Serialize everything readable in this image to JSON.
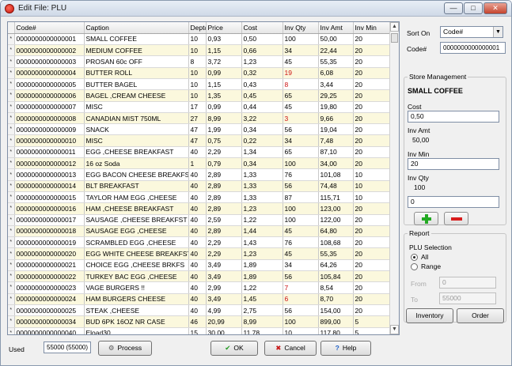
{
  "window": {
    "title": "Edit File: PLU"
  },
  "grid": {
    "columns": [
      "Code#",
      "Caption",
      "Dept#",
      "Price",
      "Cost",
      "Inv Qty",
      "Inv Amt",
      "Inv Min"
    ],
    "rows": [
      [
        "0000000000000001",
        "SMALL COFFEE",
        "10",
        "0,93",
        "0,50",
        "100",
        "50,00",
        "20"
      ],
      [
        "0000000000000002",
        "MEDIUM COFFEE",
        "10",
        "1,15",
        "0,66",
        "34",
        "22,44",
        "20"
      ],
      [
        "0000000000000003",
        "PROSAN 60c OFF",
        "8",
        "3,72",
        "1,23",
        "45",
        "55,35",
        "20"
      ],
      [
        "0000000000000004",
        "BUTTER ROLL",
        "10",
        "0,99",
        "0,32",
        "19",
        "6,08",
        "20"
      ],
      [
        "0000000000000005",
        "BUTTER BAGEL",
        "10",
        "1,15",
        "0,43",
        "8",
        "3,44",
        "20"
      ],
      [
        "0000000000000006",
        "BAGEL ,CREAM CHEESE",
        "10",
        "1,35",
        "0,45",
        "65",
        "29,25",
        "20"
      ],
      [
        "0000000000000007",
        "MISC",
        "17",
        "0,99",
        "0,44",
        "45",
        "19,80",
        "20"
      ],
      [
        "0000000000000008",
        "CANADIAN MIST 750ML",
        "27",
        "8,99",
        "3,22",
        "3",
        "9,66",
        "20"
      ],
      [
        "0000000000000009",
        "SNACK",
        "47",
        "1,99",
        "0,34",
        "56",
        "19,04",
        "20"
      ],
      [
        "0000000000000010",
        "MISC",
        "47",
        "0,75",
        "0,22",
        "34",
        "7,48",
        "20"
      ],
      [
        "0000000000000011",
        "EGG ,CHEESE BREAKFAST",
        "40",
        "2,29",
        "1,34",
        "65",
        "87,10",
        "20"
      ],
      [
        "0000000000000012",
        "16 oz Soda",
        "1",
        "0,79",
        "0,34",
        "100",
        "34,00",
        "20"
      ],
      [
        "0000000000000013",
        "EGG BACON CHEESE BREAKFST",
        "40",
        "2,89",
        "1,33",
        "76",
        "101,08",
        "10"
      ],
      [
        "0000000000000014",
        "BLT BREAKFAST",
        "40",
        "2,89",
        "1,33",
        "56",
        "74,48",
        "10"
      ],
      [
        "0000000000000015",
        "TAYLOR HAM EGG ,CHEESE",
        "40",
        "2,89",
        "1,33",
        "87",
        "115,71",
        "10"
      ],
      [
        "0000000000000016",
        "HAM ,CHEESE BREAKFAST",
        "40",
        "2,89",
        "1,23",
        "100",
        "123,00",
        "20"
      ],
      [
        "0000000000000017",
        "SAUSAGE ,CHEESE BREAKFST",
        "40",
        "2,59",
        "1,22",
        "100",
        "122,00",
        "20"
      ],
      [
        "0000000000000018",
        "SAUSAGE EGG ,CHEESE",
        "40",
        "2,89",
        "1,44",
        "45",
        "64,80",
        "20"
      ],
      [
        "0000000000000019",
        "SCRAMBLED EGG ,CHEESE",
        "40",
        "2,29",
        "1,43",
        "76",
        "108,68",
        "20"
      ],
      [
        "0000000000000020",
        "EGG WHITE CHEESE BREAKFST",
        "40",
        "2,29",
        "1,23",
        "45",
        "55,35",
        "20"
      ],
      [
        "0000000000000021",
        "CHOICE EGG ,CHEESE BRKFS",
        "40",
        "3,49",
        "1,89",
        "34",
        "64,26",
        "20"
      ],
      [
        "0000000000000022",
        "TURKEY BAC EGG ,CHEESE",
        "40",
        "3,49",
        "1,89",
        "56",
        "105,84",
        "20"
      ],
      [
        "0000000000000023",
        "VAGE BURGERS !!",
        "40",
        "2,99",
        "1,22",
        "7",
        "8,54",
        "20"
      ],
      [
        "0000000000000024",
        "HAM BURGERS CHEESE",
        "40",
        "3,49",
        "1,45",
        "6",
        "8,70",
        "20"
      ],
      [
        "0000000000000025",
        "STEAK ,CHEESE",
        "40",
        "4,99",
        "2,75",
        "56",
        "154,00",
        "20"
      ],
      [
        "0000000000000034",
        "BUD 6PK 16OZ NR CASE",
        "46",
        "20,99",
        "8,99",
        "100",
        "899,00",
        "5"
      ],
      [
        "0000000000000040",
        "Eload30",
        "15",
        "30,00",
        "11,78",
        "10",
        "117,80",
        "5"
      ]
    ],
    "low_qty_color": "#cc1111"
  },
  "sidebar": {
    "sort_on_label": "Sort On",
    "sort_on_value": "Code#",
    "code_label": "Code#",
    "code_value": "0000000000000001",
    "store_mgmt": {
      "title": "Store Management",
      "item_name": "SMALL COFFEE",
      "cost_label": "Cost",
      "cost_value": "0,50",
      "inv_amt_label": "Inv Amt",
      "inv_amt_value": "50,00",
      "inv_min_label": "Inv Min",
      "inv_min_value": "20",
      "inv_qty_label": "Inv Qty",
      "inv_qty_value": "100",
      "adjust_value": "0"
    },
    "report": {
      "title": "Report",
      "plu_selection_label": "PLU Selection",
      "all_label": "All",
      "range_label": "Range",
      "from_label": "From",
      "from_value": "0",
      "to_label": "To",
      "to_value": "55000",
      "inventory_button": "Inventory",
      "order_button": "Order"
    }
  },
  "footer": {
    "used_label": "Used",
    "used_value": "55000 (55000)",
    "process_button": "Process",
    "ok_button": "OK",
    "cancel_button": "Cancel",
    "help_button": "Help"
  }
}
